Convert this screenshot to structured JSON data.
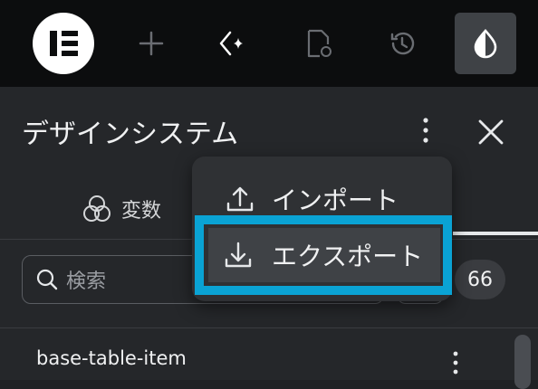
{
  "topbar": {
    "buttons": [
      {
        "icon": "elementor-logo-icon"
      },
      {
        "icon": "plus-icon"
      },
      {
        "icon": "ai-sparkle-icon"
      },
      {
        "icon": "page-settings-icon"
      },
      {
        "icon": "history-icon"
      },
      {
        "icon": "droplet-icon",
        "active": true
      }
    ]
  },
  "panel": {
    "title": "デザインシステム",
    "tab_label": "変数",
    "search_placeholder": "検索",
    "count": "66",
    "row_label": "base-table-item"
  },
  "menu": {
    "import_label": "インポート",
    "export_label": "エクスポート"
  },
  "colors": {
    "highlight": "#0aa3d4",
    "topbar_bg": "#0c0d0e",
    "panel_bg": "#25272a"
  }
}
